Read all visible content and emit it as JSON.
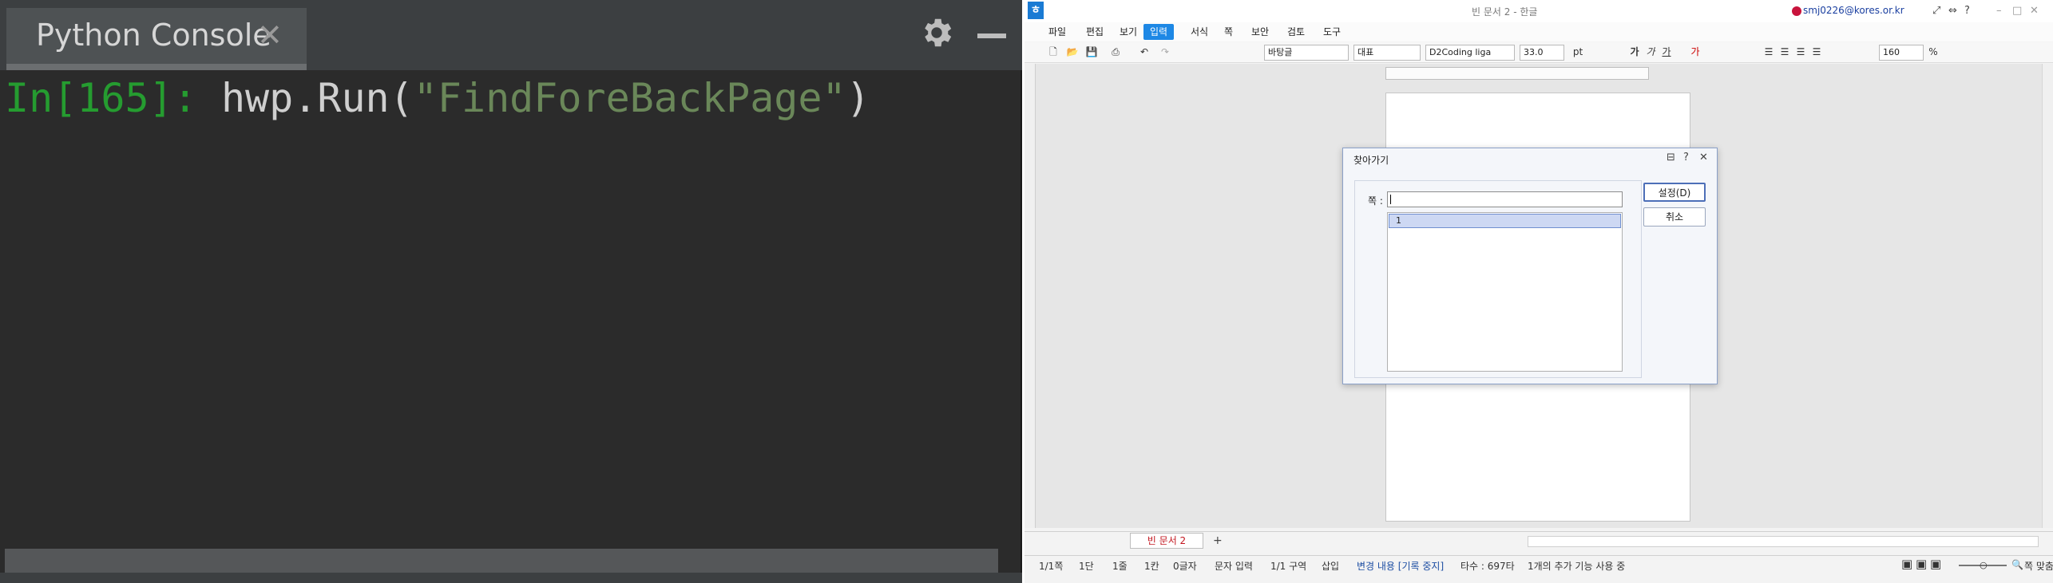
{
  "console": {
    "tab_title": "Python Console",
    "close_glyph": "✕",
    "prompt": "In[165]: ",
    "code_prefix": "hwp.Run(",
    "code_string": "\"FindForeBackPage\"",
    "code_suffix": ")",
    "settings_icon": "gear-icon",
    "minimize_icon": "minimize-icon"
  },
  "hwp": {
    "window_title": "빈 문서 2 - 한글",
    "user_email": "smj0226@kores.or.kr",
    "menu": [
      "파일",
      "편집",
      "보기",
      "입력",
      "서식",
      "쪽",
      "보안",
      "검토",
      "도구"
    ],
    "active_menu": "입력",
    "toolbar": {
      "style": "바탕글",
      "outline": "대표",
      "font": "D2Coding liga",
      "font_size": "33.0",
      "size_unit": "pt",
      "zoom": "160",
      "zoom_unit": "%"
    },
    "doc_tab": "빈 문서 2",
    "add_tab": "+",
    "status": {
      "page": "1/1쪽",
      "column": "1단",
      "line": "1줄",
      "col": "1칸",
      "chars": "0글자",
      "mode": "문자 입력",
      "section": "1/1 구역",
      "insert": "삽입",
      "track": "변경 내용 [기록 중지]",
      "typing": "타수 : 697타",
      "extra": "1개의 추가 기능 사용 중",
      "fit": "쪽 맞춤"
    },
    "dialog": {
      "title": "찾아가기",
      "page_label": "쪽 :",
      "input_value": "",
      "list_items": [
        "1"
      ],
      "ok_label": "설정(D)",
      "cancel_label": "취소"
    },
    "accent_color": "#1e88e5"
  }
}
